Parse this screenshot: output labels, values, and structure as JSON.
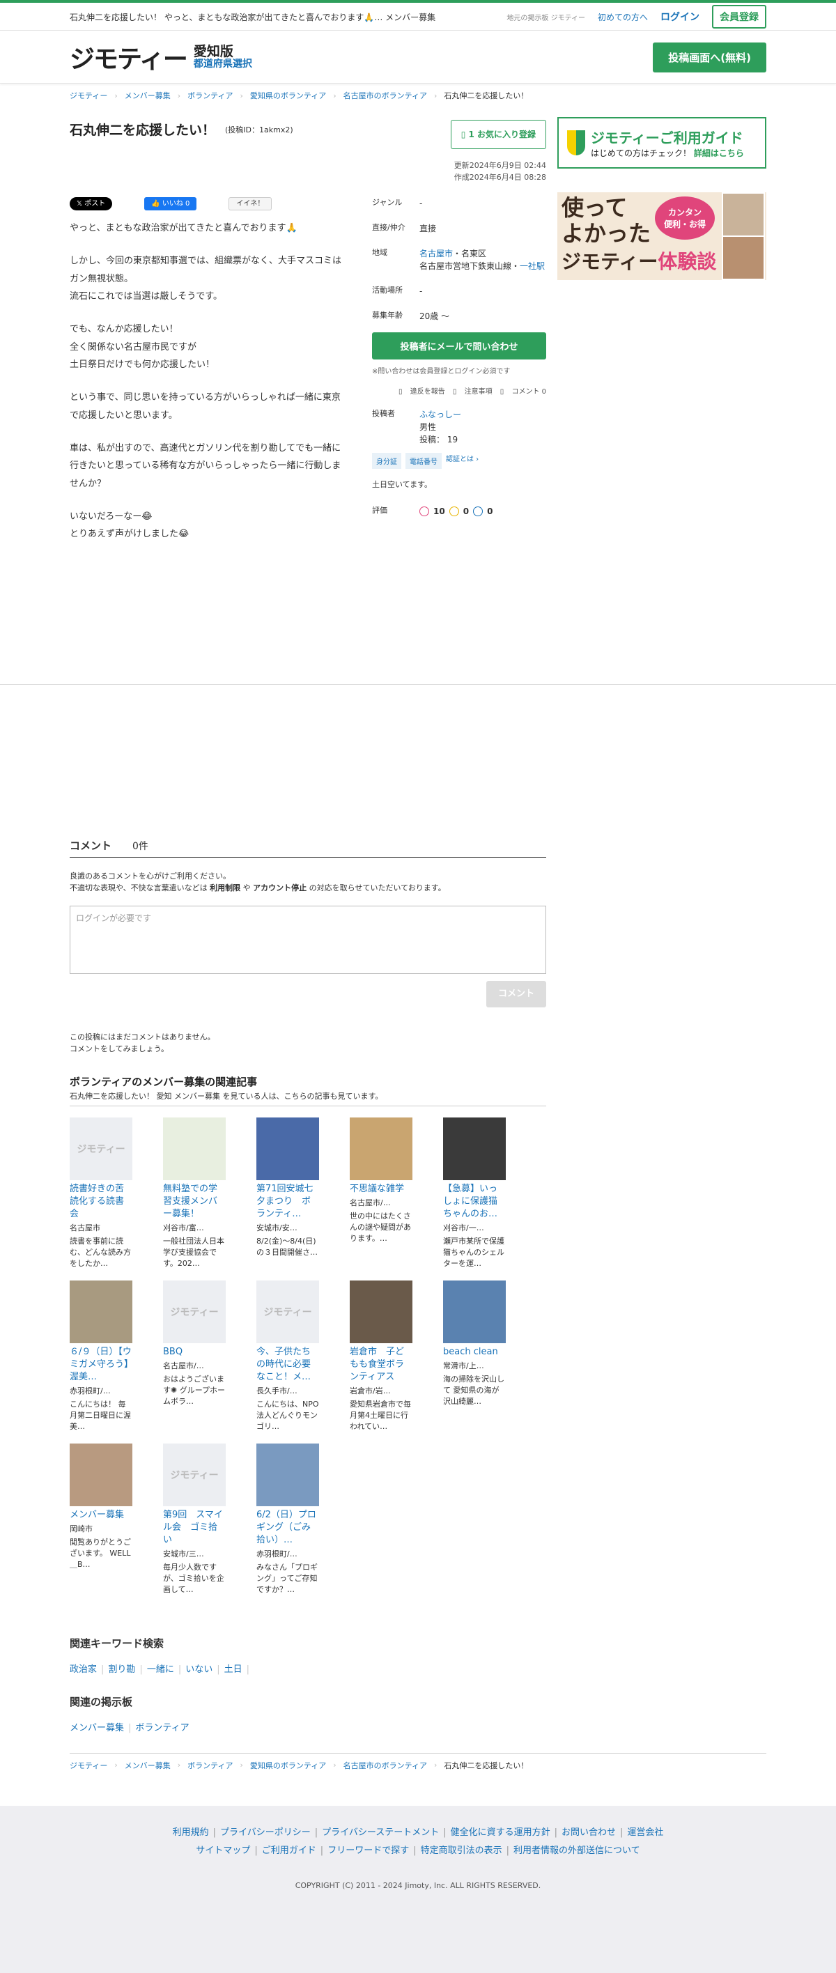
{
  "topbar": {
    "message": "石丸伸二を応援したい！ やっと、まともな政治家が出てきたと喜んでおります🙏… メンバー募集",
    "small": "地元の掲示板 ジモティー",
    "first": "初めての方へ",
    "login": "ログイン",
    "register": "会員登録"
  },
  "header": {
    "logo": "ジモティー",
    "pref": "愛知版",
    "pref_select": "都道府県選択",
    "post_button": "投稿画面へ(無料)"
  },
  "breadcrumbs": [
    "ジモティー",
    "メンバー募集",
    "ボランティア",
    "愛知県のボランティア",
    "名古屋市のボランティア",
    "石丸伸二を応援したい！"
  ],
  "post": {
    "title": "石丸伸二を応援したい！",
    "post_id": "(投稿ID：1akmx2)",
    "fav_button": "1 お気に入り登録",
    "updated": "更新2024年6月9日 02:44",
    "created": "作成2024年6月4日 08:28",
    "social": {
      "x": "𝕏 ポスト",
      "fb": "👍 いいね 0",
      "iine": "イイネ！"
    },
    "body": [
      "やっと、まともな政治家が出てきたと喜んでおります🙏",
      "しかし、今回の東京都知事選では、組織票がなく、大手マスコミはガン無視状態。\n流石にこれでは当選は厳しそうです。",
      "でも、なんか応援したい！\n全く関係ない名古屋市民ですが\n土日祭日だけでも何か応援したい！",
      "という事で、同じ思いを持っている方がいらっしゃれば一緒に東京で応援したいと思います。",
      "車は、私が出すので、高速代とガソリン代を割り勘してでも一緒に行きたいと思っている稀有な方がいらっしゃったら一緒に行動しませんか？",
      "いないだろーなー😂\nとりあえず声がけしました😂"
    ]
  },
  "info": {
    "genre_label": "ジャンル",
    "genre": "-",
    "method_label": "直接/仲介",
    "method": "直接",
    "area_label": "地域",
    "area_city": "名古屋市",
    "area_ward": "・名東区",
    "station": "名古屋市営地下鉄東山線・",
    "station_link": "一社駅",
    "place_label": "活動場所",
    "place": "-",
    "age_label": "募集年齢",
    "age": "20歳 〜",
    "contact": "投稿者にメールで問い合わせ",
    "note": "※問い合わせは会員登録とログイン必須です",
    "report": "違反を報告",
    "caution": "注意事項",
    "comment_count": "コメント 0",
    "poster_label": "投稿者",
    "poster_name": "ふなっしー",
    "poster_gender": "男性",
    "poster_posts": "投稿： 19",
    "badge_id": "身分証",
    "badge_phone": "電話番号",
    "badge_what": "認証とは ›",
    "availability": "土日空いてます。",
    "rating_label": "評価",
    "rating_good": "10",
    "rating_normal": "0",
    "rating_bad": "0"
  },
  "side": {
    "guide_title": "ジモティーご利用ガイド",
    "guide_sub": "はじめての方はチェック！",
    "guide_link": "詳細はこちら",
    "banner_line1": "使って",
    "banner_line2": "よかった",
    "banner_bubble": "カンタン\n便利・お得",
    "banner_brand": "ジモティー",
    "banner_suffix": "体験談"
  },
  "comments": {
    "heading": "コメント",
    "count": "0件",
    "rule1": "良識のあるコメントを心がけご利用ください。",
    "rule2_pre": "不適切な表現や、不快な言葉遣いなどは",
    "rule2_b1": "利用制限",
    "rule2_mid": "や",
    "rule2_b2": "アカウント停止",
    "rule2_post": "の対応を取らせていただいております。",
    "placeholder": "ログインが必要です",
    "submit": "コメント",
    "none1": "この投稿にはまだコメントはありません。",
    "none2": "コメントをしてみましょう。"
  },
  "related": {
    "heading": "ボランティアのメンバー募集の関連記事",
    "sub": "石丸伸二を応援したい！ 愛知 メンバー募集 を見ている人は、こちらの記事も見ています。",
    "items": [
      {
        "title": "読書好きの苦読化する読書会",
        "loc": "名古屋市",
        "desc": "読書を事前に読む、どんな読み方をしたか…",
        "thumb": "ジモティー",
        "color": "#eceef2"
      },
      {
        "title": "無料塾での学習支援メンバー募集！",
        "loc": "刈谷市/富…",
        "desc": "一般社団法人日本学び支援協会です。202…",
        "thumb": "",
        "color": "#e8efe0"
      },
      {
        "title": "第71回安城七夕まつり　ボランティ…",
        "loc": "安城市/安…",
        "desc": "8/2(金)〜8/4(日)の３日間開催さ…",
        "thumb": "",
        "color": "#4a6aa8"
      },
      {
        "title": "不思議な雑学",
        "loc": "名古屋市/…",
        "desc": "世の中にはたくさんの謎や疑問があります。…",
        "thumb": "",
        "color": "#c9a570"
      },
      {
        "title": "【急募】いっしょに保護猫ちゃんのお…",
        "loc": "刈谷市/一…",
        "desc": "瀬戸市某所で保護猫ちゃんのシェルターを運…",
        "thumb": "",
        "color": "#3a3a3a"
      },
      {
        "title": "６/９（日）【ウミガメ守ろう】渥美…",
        "loc": "赤羽根町/…",
        "desc": "こんにちは！ 毎月第二日曜日に渥美…",
        "thumb": "",
        "color": "#a89a80"
      },
      {
        "title": "BBQ",
        "loc": "名古屋市/…",
        "desc": "おはようございます✺ グループホームボラ…",
        "thumb": "ジモティー",
        "color": "#eceef2"
      },
      {
        "title": "今、子供たちの時代に必要なこと！メ…",
        "loc": "長久手市/…",
        "desc": "こんにちは、NPO法人どんぐりモンゴリ…",
        "thumb": "ジモティー",
        "color": "#eceef2"
      },
      {
        "title": "岩倉市　子どもも食堂ボランティアスタ…",
        "loc": "岩倉市/岩…",
        "desc": "愛知県岩倉市で毎月第4土曜日に行われてい…",
        "thumb": "",
        "color": "#6a5a4a"
      },
      {
        "title": "beach clean",
        "loc": "常滑市/上…",
        "desc": "海の掃除を沢山して 愛知県の海が沢山綺麗…",
        "thumb": "",
        "color": "#5a82b0"
      },
      {
        "title": "メンバー募集",
        "loc": "岡崎市",
        "desc": "閲覧ありがとうございます。 WELL＿B…",
        "thumb": "",
        "color": "#b89a80"
      },
      {
        "title": "第9回　スマイル会　ゴミ拾い",
        "loc": "安城市/三…",
        "desc": "毎月少人数ですが、ゴミ拾いを企画して…",
        "thumb": "ジモティー",
        "color": "#eceef2"
      },
      {
        "title": "6/2（日）プロギング（ごみ拾い）…",
        "loc": "赤羽根町/…",
        "desc": "みなさん「プロギング」ってご存知ですか？…",
        "thumb": "",
        "color": "#7a9ac0"
      }
    ]
  },
  "keywords": {
    "heading": "関連キーワード検索",
    "items": [
      "政治家",
      "割り勘",
      "一緒に",
      "いない",
      "土日"
    ],
    "board_heading": "関連の掲示板",
    "boards": [
      "メンバー募集",
      "ボランティア"
    ]
  },
  "footer": {
    "row1": [
      "利用規約",
      "プライバシーポリシー",
      "プライバシーステートメント",
      "健全化に資する運用方針",
      "お問い合わせ",
      "運営会社"
    ],
    "row2": [
      "サイトマップ",
      "ご利用ガイド",
      "フリーワードで探す",
      "特定商取引法の表示",
      "利用者情報の外部送信について"
    ],
    "copyright": "COPYRIGHT (C) 2011 - 2024 Jimoty, Inc. ALL RIGHTS RESERVED."
  },
  "colors": {
    "brand_green": "#2e9e5b",
    "link_blue": "#1a73b8"
  }
}
